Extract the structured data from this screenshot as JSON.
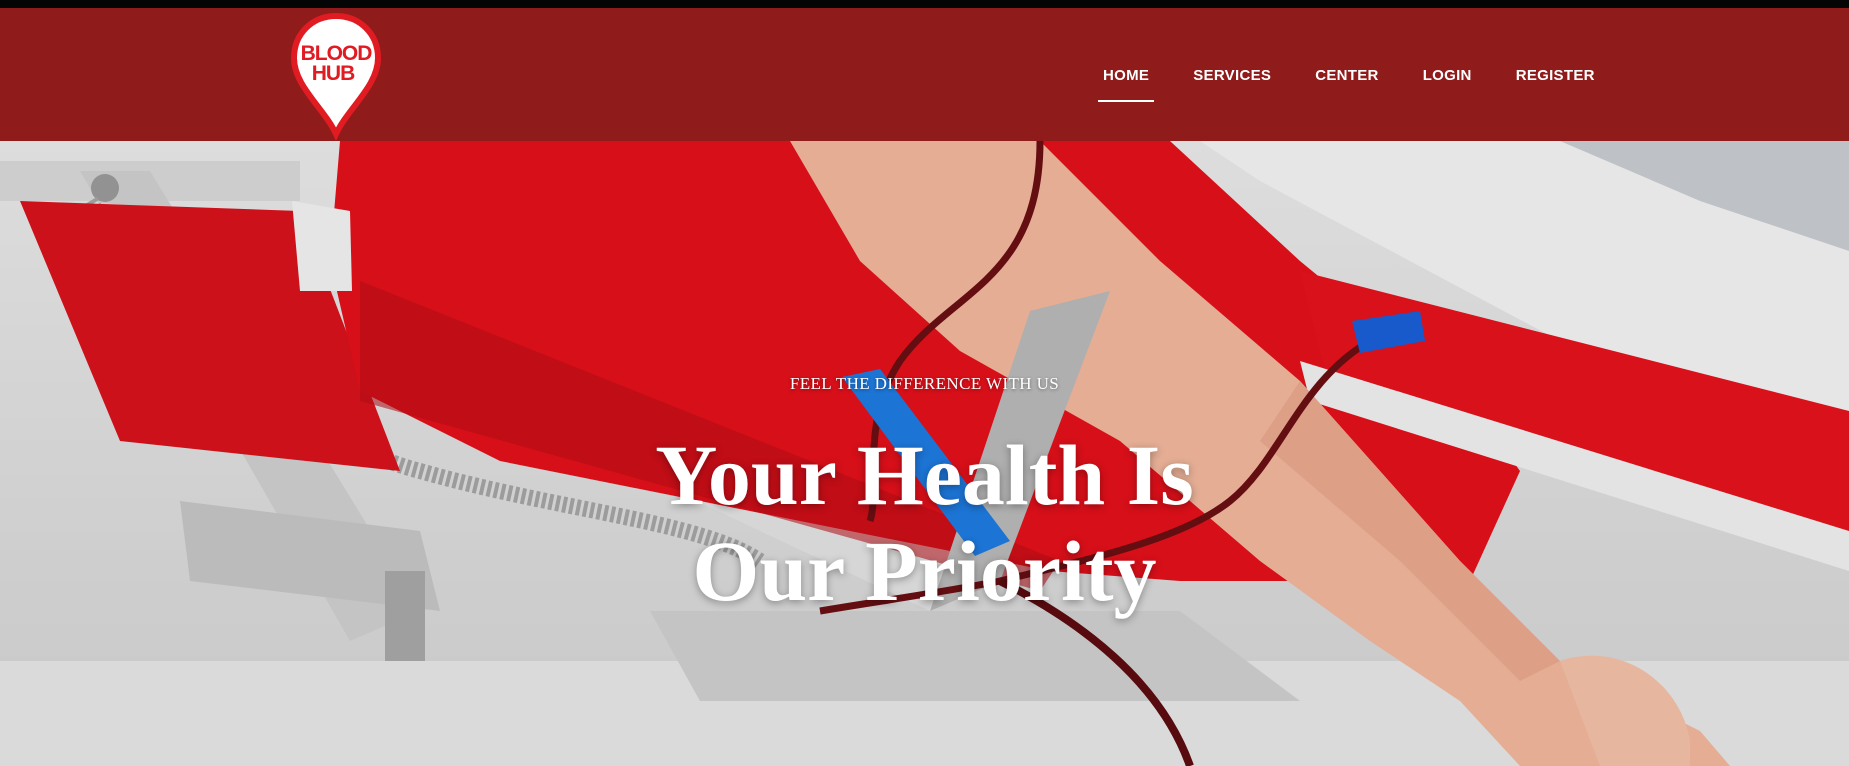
{
  "brand": {
    "logo_line1": "BLOOD",
    "logo_line2": "HUB",
    "logo_color": "#e11b22",
    "header_color": "#8f1b1b"
  },
  "nav": {
    "items": [
      {
        "label": "HOME",
        "active": true
      },
      {
        "label": "SERVICES",
        "active": false
      },
      {
        "label": "CENTER",
        "active": false
      },
      {
        "label": "LOGIN",
        "active": false
      },
      {
        "label": "REGISTER",
        "active": false
      }
    ]
  },
  "hero": {
    "kicker": "FEEL THE DIFFERENCE WITH US",
    "title_bold": "Your Health",
    "title_rest_line1": " Is",
    "title_line2": "Our Priority",
    "image_subject": "blood donation arm on red donor chair"
  }
}
